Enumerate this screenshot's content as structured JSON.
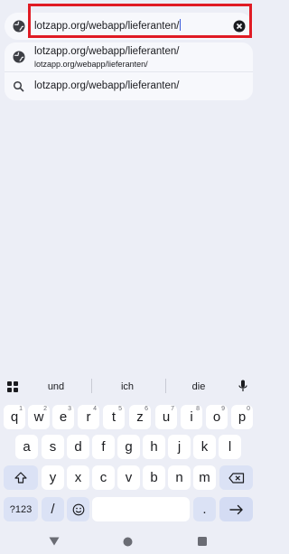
{
  "omnibox": {
    "url": "lotzapp.org/webapp/lieferanten/",
    "icons": {
      "site": "globe-icon",
      "clear": "close-circle-icon"
    }
  },
  "suggestions": [
    {
      "icon": "globe-icon",
      "title": "lotzapp.org/webapp/lieferanten/",
      "subtitle": "lotzapp.org/webapp/lieferanten/"
    },
    {
      "icon": "search-icon",
      "title": "lotzapp.org/webapp/lieferanten/"
    }
  ],
  "keyboard": {
    "strip": {
      "menu_icon": "grid-icon",
      "words": [
        "und",
        "ich",
        "die"
      ],
      "mic_icon": "mic-icon"
    },
    "row1": [
      {
        "k": "q",
        "h": "1"
      },
      {
        "k": "w",
        "h": "2"
      },
      {
        "k": "e",
        "h": "3"
      },
      {
        "k": "r",
        "h": "4"
      },
      {
        "k": "t",
        "h": "5"
      },
      {
        "k": "z",
        "h": "6"
      },
      {
        "k": "u",
        "h": "7"
      },
      {
        "k": "i",
        "h": "8"
      },
      {
        "k": "o",
        "h": "9"
      },
      {
        "k": "p",
        "h": "0"
      }
    ],
    "row2": [
      "a",
      "s",
      "d",
      "f",
      "g",
      "h",
      "j",
      "k",
      "l"
    ],
    "row3": [
      "y",
      "x",
      "c",
      "v",
      "b",
      "n",
      "m"
    ],
    "bottom": {
      "symbols": "?123",
      "slash": "/",
      "period": "."
    },
    "icons": {
      "shift": "shift-icon",
      "backspace": "backspace-icon",
      "emoji": "emoji-icon",
      "enter": "arrow-right-icon"
    }
  },
  "navbar": {
    "icons": [
      "back-icon",
      "home-icon",
      "recents-icon"
    ]
  },
  "colors": {
    "background": "#eceef6",
    "highlight": "#e01b24",
    "key": "#ffffff",
    "modkey": "#dbe2f5"
  }
}
